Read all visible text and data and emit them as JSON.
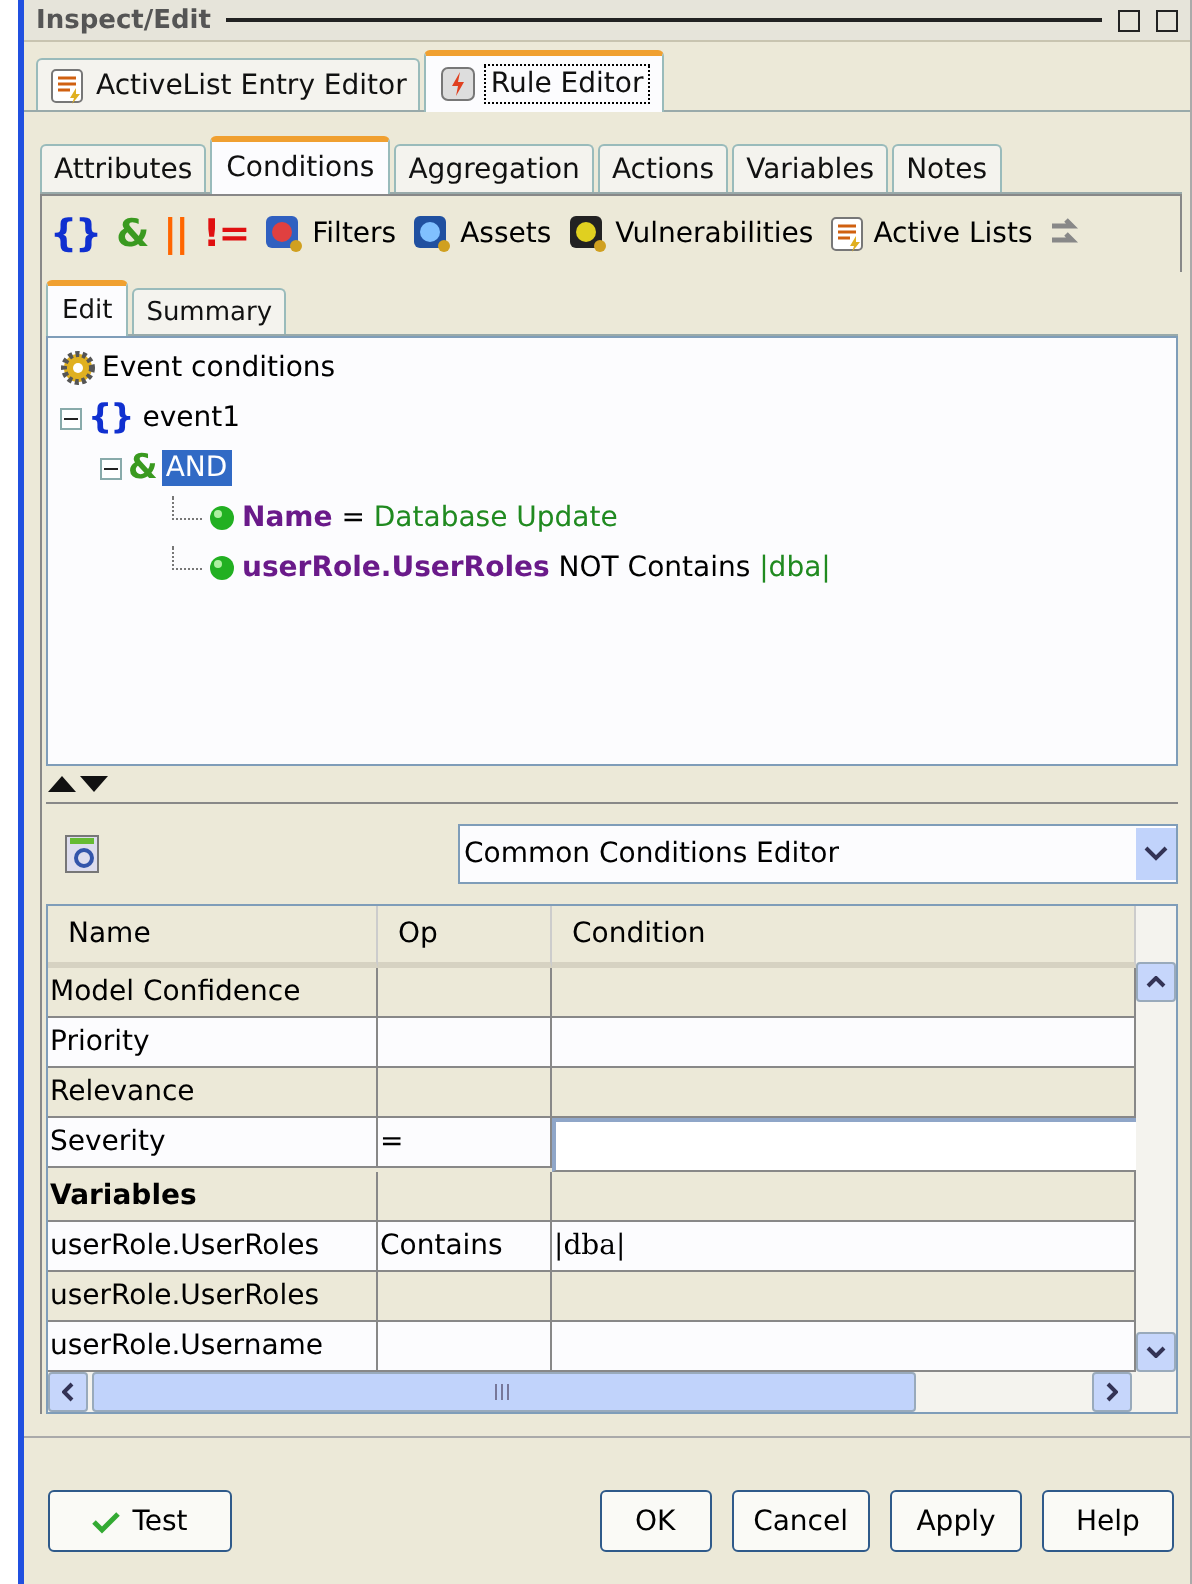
{
  "window": {
    "title": "Inspect/Edit"
  },
  "editor_tabs": [
    {
      "label": "ActiveList Entry Editor",
      "selected": false,
      "kind": "list"
    },
    {
      "label": "Rule Editor",
      "selected": true,
      "kind": "rule"
    }
  ],
  "section_tabs": [
    {
      "label": "Attributes",
      "selected": false
    },
    {
      "label": "Conditions",
      "selected": true
    },
    {
      "label": "Aggregation",
      "selected": false
    },
    {
      "label": "Actions",
      "selected": false
    },
    {
      "label": "Variables",
      "selected": false
    },
    {
      "label": "Notes",
      "selected": false
    }
  ],
  "toolbar": [
    {
      "kind": "glyph",
      "text": "{}",
      "color": "#1030d0"
    },
    {
      "kind": "glyph",
      "text": "&",
      "color": "#3a9a20"
    },
    {
      "kind": "glyph",
      "text": "||",
      "color": "#ff6600"
    },
    {
      "kind": "glyph",
      "text": "!=",
      "color": "#e01010"
    },
    {
      "kind": "filters",
      "text": "Filters"
    },
    {
      "kind": "assets",
      "text": "Assets"
    },
    {
      "kind": "vulnerabilities",
      "text": "Vulnerabilities"
    },
    {
      "kind": "activelists",
      "text": "Active Lists"
    }
  ],
  "view_tabs": [
    {
      "label": "Edit",
      "selected": true
    },
    {
      "label": "Summary",
      "selected": false
    }
  ],
  "tree": {
    "label": "Event conditions",
    "children": [
      {
        "kind": "event",
        "glyph": "{}",
        "label": "event1",
        "expanded": true,
        "selected": false,
        "children": [
          {
            "kind": "and",
            "glyph": "&",
            "label": "AND",
            "expanded": true,
            "selected": true,
            "children": [
              {
                "kind": "condition",
                "field": "Name",
                "op": "=",
                "value": "Database Update",
                "selected": false
              },
              {
                "kind": "condition",
                "field": "userRole.UserRoles",
                "op": "NOT Contains",
                "value": "|dba|",
                "selected": false
              }
            ]
          }
        ]
      }
    ]
  },
  "editor_select": {
    "value": "Common Conditions Editor"
  },
  "table": {
    "columns": [
      "Name",
      "Op",
      "Condition"
    ],
    "rows": [
      {
        "kind": "item",
        "name": "Model Confidence",
        "op": "",
        "condition": ""
      },
      {
        "kind": "item",
        "name": "Priority",
        "op": "",
        "condition": ""
      },
      {
        "kind": "item",
        "name": "Relevance",
        "op": "",
        "condition": ""
      },
      {
        "kind": "editing",
        "name": "Severity",
        "op": "=",
        "condition": ""
      },
      {
        "kind": "section",
        "name": "Variables",
        "op": "",
        "condition": ""
      },
      {
        "kind": "item",
        "name": "userRole.UserRoles",
        "op": "Contains",
        "condition": "|dba|"
      },
      {
        "kind": "item",
        "name": "userRole.UserRoles",
        "op": "",
        "condition": ""
      },
      {
        "kind": "item",
        "name": "userRole.Username",
        "op": "",
        "condition": ""
      }
    ]
  },
  "buttons": [
    {
      "label": "Test",
      "kind": "test"
    },
    {
      "label": "OK",
      "kind": "plain"
    },
    {
      "label": "Cancel",
      "kind": "plain"
    },
    {
      "label": "Apply",
      "kind": "plain"
    },
    {
      "label": "Help",
      "kind": "plain"
    }
  ]
}
